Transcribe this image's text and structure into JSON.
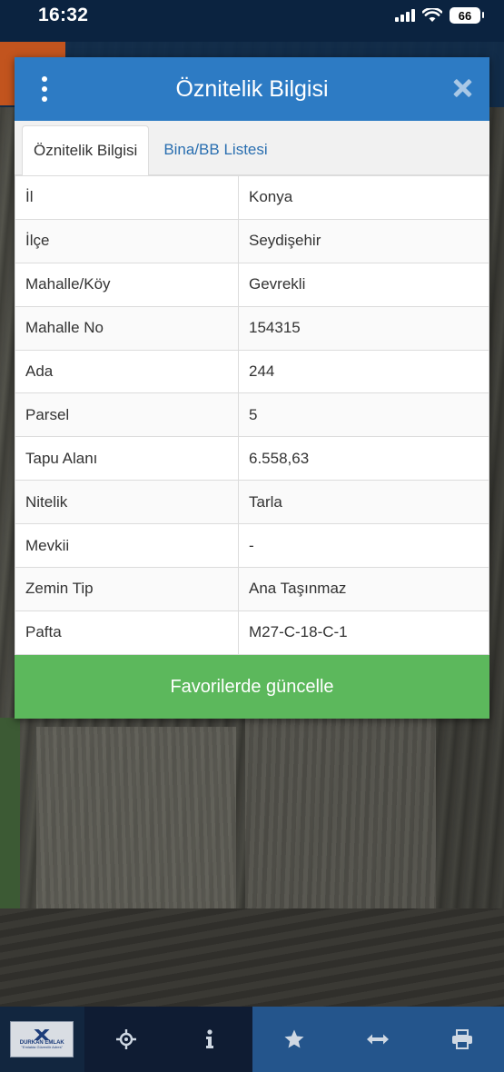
{
  "status_bar": {
    "time": "16:32",
    "battery": "66",
    "icons": [
      "signal-icon",
      "wifi-icon",
      "battery-icon"
    ]
  },
  "dialog": {
    "title": "Öznitelik Bilgisi",
    "tabs": [
      {
        "label": "Öznitelik Bilgisi",
        "active": true
      },
      {
        "label": "Bina/BB Listesi",
        "active": false
      }
    ],
    "rows": [
      {
        "key": "İl",
        "value": "Konya"
      },
      {
        "key": "İlçe",
        "value": "Seydişehir"
      },
      {
        "key": "Mahalle/Köy",
        "value": "Gevrekli"
      },
      {
        "key": "Mahalle No",
        "value": "154315"
      },
      {
        "key": "Ada",
        "value": "244"
      },
      {
        "key": "Parsel",
        "value": "5"
      },
      {
        "key": "Tapu Alanı",
        "value": "6.558,63"
      },
      {
        "key": "Nitelik",
        "value": "Tarla"
      },
      {
        "key": "Mevkii",
        "value": "-"
      },
      {
        "key": "Zemin Tip",
        "value": "Ana Taşınmaz"
      },
      {
        "key": "Pafta",
        "value": "M27-C-18-C-1"
      }
    ],
    "favorite_button": "Favorilerde güncelle"
  },
  "toolbar": {
    "logo_text_1": "DURKAN EMLAK",
    "logo_text_2": "\"Emlakta Güvenilir Adres\"",
    "items": [
      "locate-icon",
      "info-icon",
      "star-icon",
      "measure-icon",
      "print-icon"
    ]
  },
  "colors": {
    "header_blue": "#2d7bc4",
    "button_green": "#5cb85c",
    "tab_link": "#2a6fb0"
  }
}
